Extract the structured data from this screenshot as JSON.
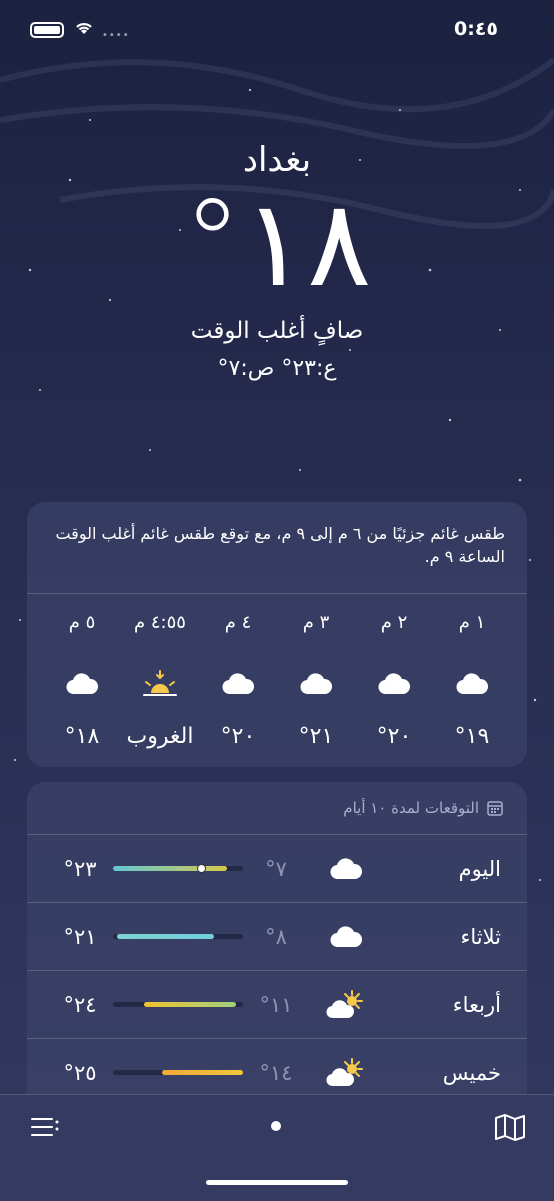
{
  "status": {
    "time": "0:٤٥"
  },
  "hero": {
    "city": "بغداد",
    "temperature": "°١٨",
    "condition": "صافٍ أغلب الوقت",
    "high_low": "ع:٢٣° ص:٧°"
  },
  "hourly": {
    "summary": "طقس غائم جزئيًا من ٦ م إلى ٩ م، مع توقع طقس غائم أغلب الوقت الساعة ٩ م.",
    "hours": [
      {
        "label": "١ م",
        "icon": "cloud-icon",
        "value": "°١٩"
      },
      {
        "label": "٢ م",
        "icon": "cloud-icon",
        "value": "°٢٠"
      },
      {
        "label": "٣ م",
        "icon": "cloud-icon",
        "value": "°٢١"
      },
      {
        "label": "٤ م",
        "icon": "cloud-icon",
        "value": "°٢٠"
      },
      {
        "label": "٤:٥٥ م",
        "icon": "sunset-icon",
        "value": "الغروب"
      },
      {
        "label": "٥ م",
        "icon": "cloud-icon",
        "value": "°١٨"
      }
    ]
  },
  "daily": {
    "header": "التوقعات لمدة ١٠ أيام",
    "days": [
      {
        "name": "اليوم",
        "icon": "cloud-icon",
        "low": "°٧",
        "high": "°٢٣",
        "range_start": 0.12,
        "range_end": 1.0,
        "current": 0.32,
        "colors": [
          "#d7c94a",
          "#62c7d6"
        ]
      },
      {
        "name": "ثلاثاء",
        "icon": "cloud-icon",
        "low": "°٨",
        "high": "°٢١",
        "range_start": 0.22,
        "range_end": 0.97,
        "colors": [
          "#6fd0dc",
          "#7fd3d0"
        ]
      },
      {
        "name": "أربعاء",
        "icon": "partly-sunny-icon",
        "low": "°١١",
        "high": "°٢٤",
        "range_start": 0.05,
        "range_end": 0.76,
        "colors": [
          "#9ed17c",
          "#f2c232"
        ]
      },
      {
        "name": "خميس",
        "icon": "partly-sunny-icon",
        "low": "°١٤",
        "high": "°٢٥",
        "range_start": 0.0,
        "range_end": 0.62,
        "colors": [
          "#f1c63d",
          "#f2a93a"
        ]
      }
    ]
  },
  "colors": {
    "background_top": "#1c2140",
    "background_bottom": "#353a60",
    "card": "#3c4268"
  }
}
